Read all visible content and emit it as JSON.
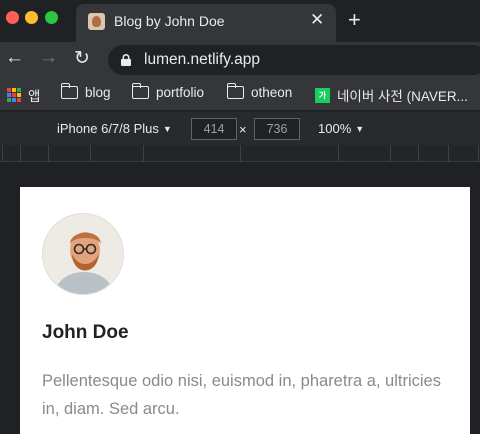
{
  "browser": {
    "tab": {
      "title": "Blog by John Doe",
      "close_icon": "close-icon"
    },
    "new_tab_icon": "plus-icon",
    "nav": {
      "back_icon": "arrow-left-icon",
      "forward_icon": "arrow-right-icon",
      "reload_icon": "reload-icon"
    },
    "address": {
      "url": "lumen.netlify.app",
      "lock_icon": "lock-icon"
    },
    "bookmarks": [
      {
        "label": "앱",
        "icon": "apps-grid-icon"
      },
      {
        "label": "blog",
        "icon": "folder-icon"
      },
      {
        "label": "portfolio",
        "icon": "folder-icon"
      },
      {
        "label": "otheon",
        "icon": "folder-icon"
      },
      {
        "label": "네이버 사전 (NAVER...",
        "icon": "naver-dictionary-icon"
      }
    ]
  },
  "devtools": {
    "device": "iPhone 6/7/8 Plus",
    "width": "414",
    "times": "×",
    "height": "736",
    "zoom": "100%"
  },
  "page": {
    "author": {
      "name": "John Doe",
      "bio": "Pellentesque odio nisi, euismod in, pharetra a, ultricies in, diam. Sed arcu."
    }
  },
  "colors": {
    "tab_bg": "#35363a",
    "frame_bg": "#202124",
    "name_text": "#222222",
    "bio_text": "#8a8a8a"
  }
}
